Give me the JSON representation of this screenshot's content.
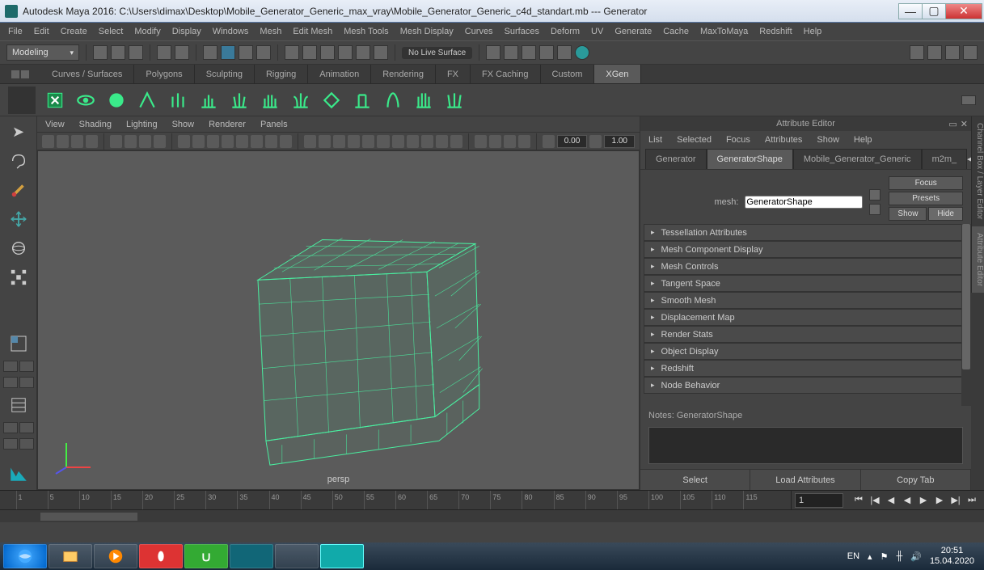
{
  "window": {
    "title": "Autodesk Maya 2016: C:\\Users\\dimax\\Desktop\\Mobile_Generator_Generic_max_vray\\Mobile_Generator_Generic_c4d_standart.mb   ---   Generator"
  },
  "main_menu": [
    "File",
    "Edit",
    "Create",
    "Select",
    "Modify",
    "Display",
    "Windows",
    "Mesh",
    "Edit Mesh",
    "Mesh Tools",
    "Mesh Display",
    "Curves",
    "Surfaces",
    "Deform",
    "UV",
    "Generate",
    "Cache",
    "MaxToMaya",
    "Redshift",
    "Help"
  ],
  "mode_dropdown": "Modeling",
  "statusline_label": "No Live Surface",
  "module_tabs": [
    "Curves / Surfaces",
    "Polygons",
    "Sculpting",
    "Rigging",
    "Animation",
    "Rendering",
    "FX",
    "FX Caching",
    "Custom",
    "XGen"
  ],
  "module_active": "XGen",
  "viewport_menu": [
    "View",
    "Shading",
    "Lighting",
    "Show",
    "Renderer",
    "Panels"
  ],
  "viewport_nums": {
    "a": "0.00",
    "b": "1.00"
  },
  "viewport_label": "persp",
  "attribute_editor": {
    "title": "Attribute Editor",
    "menu": [
      "List",
      "Selected",
      "Focus",
      "Attributes",
      "Show",
      "Help"
    ],
    "tabs": [
      "Generator",
      "GeneratorShape",
      "Mobile_Generator_Generic",
      "m2m_"
    ],
    "active_tab": "GeneratorShape",
    "mesh_label": "mesh:",
    "mesh_value": "GeneratorShape",
    "btns": {
      "focus": "Focus",
      "presets": "Presets",
      "show": "Show",
      "hide": "Hide"
    },
    "sections": [
      "Tessellation Attributes",
      "Mesh Component Display",
      "Mesh Controls",
      "Tangent Space",
      "Smooth Mesh",
      "Displacement Map",
      "Render Stats",
      "Object Display",
      "Redshift",
      "Node Behavior"
    ],
    "notes_label": "Notes: GeneratorShape",
    "bottom": [
      "Select",
      "Load Attributes",
      "Copy Tab"
    ]
  },
  "side_labels": {
    "cb": "Channel Box / Layer Editor",
    "ae": "Attribute Editor"
  },
  "timeline": {
    "ticks": [
      "1",
      "5",
      "10",
      "15",
      "20",
      "25",
      "30",
      "35",
      "40",
      "45",
      "50",
      "55",
      "60",
      "65",
      "70",
      "75",
      "80",
      "85",
      "90",
      "95",
      "100",
      "105",
      "110",
      "115"
    ],
    "field": "1"
  },
  "taskbar": {
    "lang": "EN",
    "time": "20:51",
    "date": "15.04.2020"
  }
}
